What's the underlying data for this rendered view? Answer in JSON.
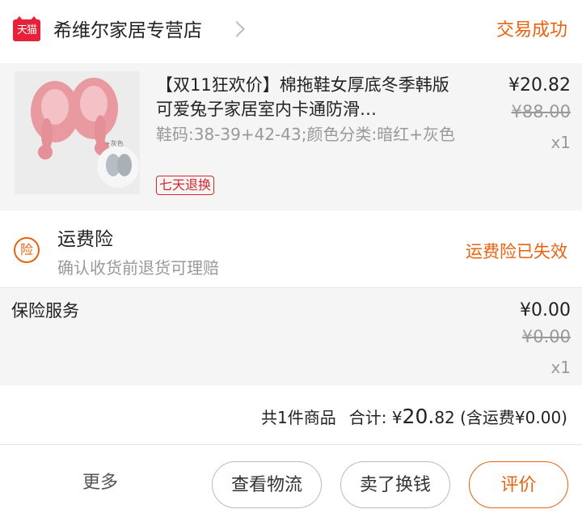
{
  "shop": {
    "logo_text": "天猫",
    "name": "希维尔家居专营店",
    "status": "交易成功"
  },
  "item": {
    "title": "【双11狂欢价】棉拖鞋女厚底冬季韩版可爱兔子家居室内卡通防滑…",
    "sku": "鞋码:38-39+42-43;颜色分类:暗红+灰色",
    "badge": "七天退换",
    "price": "¥20.82",
    "original_price": "¥88.00",
    "quantity": "x1",
    "image_caption": "+灰色"
  },
  "shipping_insurance": {
    "icon_char": "险",
    "title": "运费险",
    "description": "确认收货前退货可理赔",
    "status": "运费险已失效"
  },
  "service": {
    "name": "保险服务",
    "price": "¥0.00",
    "original_price": "¥0.00",
    "quantity": "x1"
  },
  "summary": {
    "count_text": "共1件商品",
    "total_label": "合计:",
    "currency": "¥",
    "total_int": "20.",
    "total_dec": "82",
    "shipping_note": "(含运费¥0.00)"
  },
  "actions": {
    "more": "更多",
    "logistics": "查看物流",
    "sell": "卖了换钱",
    "review": "评价"
  },
  "colors": {
    "accent": "#e8620f",
    "tmall_red": "#e8213a",
    "badge_red": "#d9262c"
  }
}
